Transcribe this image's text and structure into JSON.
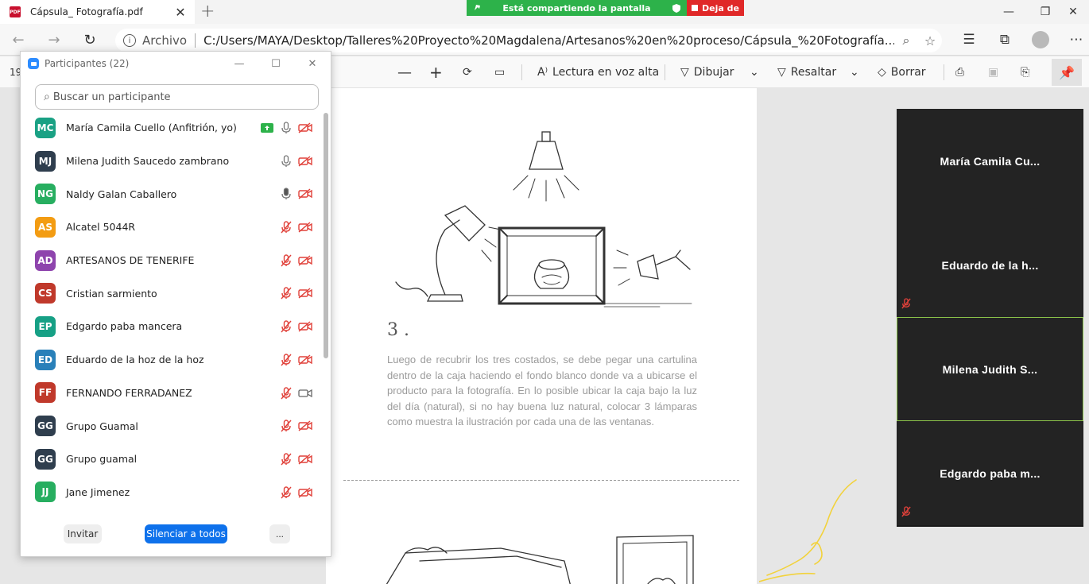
{
  "browser": {
    "tab_title": "Cápsula_ Fotografía.pdf",
    "tab_close": "✕",
    "new_tab": "+",
    "share_text": "Está compartiendo la pantalla",
    "stop_share": "Deja de",
    "url_label": "Archivo",
    "url": "C:/Users/MAYA/Desktop/Talleres%20Proyecto%20Magdalena/Artesanos%20en%20proceso/Cápsula_%20Fotografía...."
  },
  "pdf_toolbar": {
    "page_number": "19",
    "read_aloud": "Lectura en voz alta",
    "draw": "Dibujar",
    "highlight": "Resaltar",
    "erase": "Borrar"
  },
  "document": {
    "step_number": "3 .",
    "step_text": "Luego de recubrir los tres costados, se debe pegar una cartulina dentro de la caja haciendo el fondo blanco donde va a ubicarse el producto para la fotografía. En lo posible ubicar la caja bajo la  luz del día (natural), si no hay buena luz natural, colocar 3 lámparas como muestra la ilustración por cada una de las ventanas."
  },
  "participants": {
    "title": "Participantes (22)",
    "search_placeholder": "Buscar un participante",
    "items": [
      {
        "initials": "MC",
        "name": "María Camila Cuello (Anfitrión, yo)",
        "color": "#1aa184",
        "mic": "on",
        "video": "off",
        "sharing": true
      },
      {
        "initials": "MJ",
        "name": "Milena Judith Saucedo zambrano",
        "color": "#2f3e4e",
        "mic": "on",
        "video": "off"
      },
      {
        "initials": "NG",
        "name": "Naldy Galan Caballero",
        "color": "#27ae60",
        "mic": "active",
        "video": "off"
      },
      {
        "initials": "AS",
        "name": "Alcatel 5044R",
        "color": "#f39c12",
        "mic": "muted",
        "video": "off"
      },
      {
        "initials": "AD",
        "name": "ARTESANOS DE TENERIFE",
        "color": "#8e44ad",
        "mic": "muted",
        "video": "off"
      },
      {
        "initials": "CS",
        "name": "Cristian sarmiento",
        "color": "#c0392b",
        "mic": "muted",
        "video": "off"
      },
      {
        "initials": "EP",
        "name": "Edgardo paba mancera",
        "color": "#16a085",
        "mic": "muted",
        "video": "off"
      },
      {
        "initials": "ED",
        "name": "Eduardo de la hoz de la hoz",
        "color": "#2980b9",
        "mic": "muted",
        "video": "off"
      },
      {
        "initials": "FF",
        "name": "FERNANDO FERRADANEZ",
        "color": "#c0392b",
        "mic": "muted",
        "video": "on"
      },
      {
        "initials": "GG",
        "name": "Grupo Guamal",
        "color": "#2f3e4e",
        "mic": "muted",
        "video": "off"
      },
      {
        "initials": "GG",
        "name": "Grupo guamal",
        "color": "#2f3e4e",
        "mic": "muted",
        "video": "off"
      },
      {
        "initials": "JJ",
        "name": "Jane Jimenez",
        "color": "#27ae60",
        "mic": "muted",
        "video": "off"
      }
    ],
    "invite_label": "Invitar",
    "mute_all_label": "Silenciar a todos",
    "more_label": "..."
  },
  "video_tiles": [
    {
      "name": "María Camila Cu...",
      "muted": false,
      "active": false
    },
    {
      "name": "Eduardo de la h...",
      "muted": true,
      "active": false
    },
    {
      "name": "Milena Judith S...",
      "muted": false,
      "active": true
    },
    {
      "name": "Edgardo paba m...",
      "muted": true,
      "active": false
    }
  ],
  "colors": {
    "share_green": "#2db24a",
    "share_red": "#e02828",
    "zoom_blue": "#0e71eb",
    "muted_red": "#e0413a",
    "active_tile_border": "#8bc34a"
  }
}
